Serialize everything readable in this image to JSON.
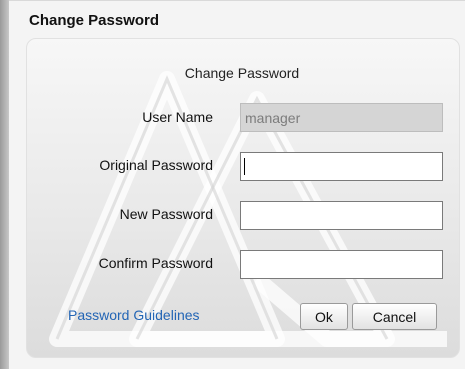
{
  "dialog": {
    "title": "Change Password",
    "heading": "Change Password"
  },
  "form": {
    "user_name": {
      "label": "User Name",
      "value": "manager"
    },
    "original_password": {
      "label": "Original Password",
      "value": ""
    },
    "new_password": {
      "label": "New Password",
      "value": ""
    },
    "confirm_password": {
      "label": "Confirm Password",
      "value": ""
    }
  },
  "footer": {
    "guidelines_link": "Password Guidelines",
    "ok_label": "Ok",
    "cancel_label": "Cancel"
  },
  "colors": {
    "link": "#2365b5",
    "disabled_field": "#d5d5d5"
  }
}
